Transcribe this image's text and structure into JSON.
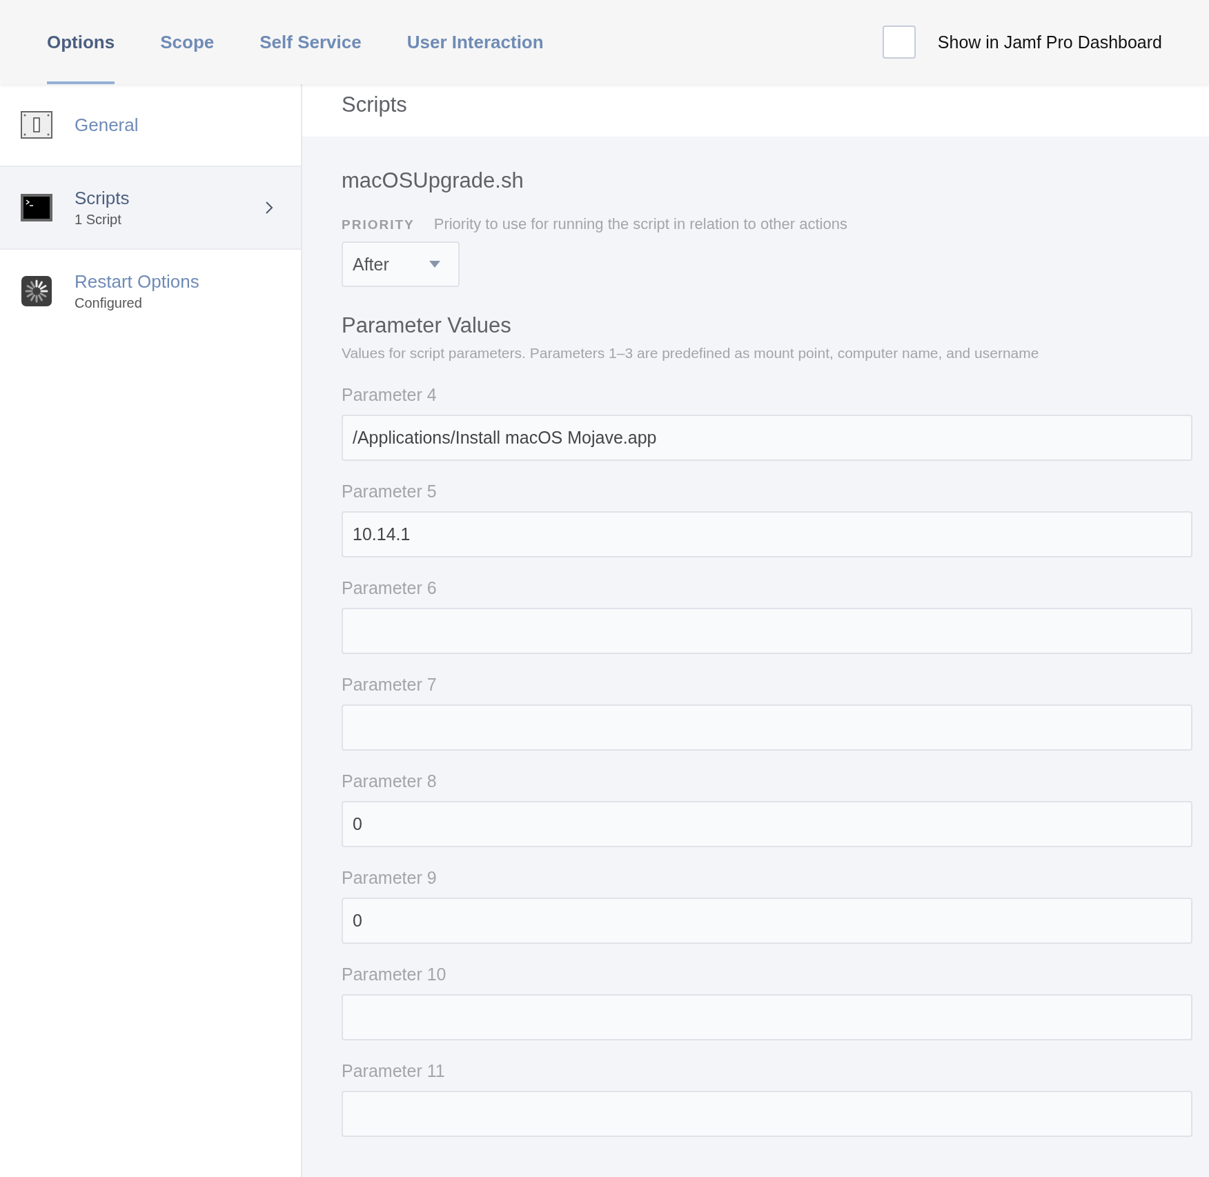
{
  "tabs": [
    {
      "label": "Options",
      "selected": true
    },
    {
      "label": "Scope",
      "selected": false
    },
    {
      "label": "Self Service",
      "selected": false
    },
    {
      "label": "User Interaction",
      "selected": false
    }
  ],
  "dashboard_option": {
    "label": "Show in Jamf Pro Dashboard",
    "checked": false
  },
  "sidebar": {
    "items": [
      {
        "kind": "switch",
        "title": "General",
        "selected": false
      },
      {
        "kind": "terminal",
        "title": "Scripts",
        "subtitle": "1 Script",
        "selected": true
      },
      {
        "kind": "spinner",
        "title": "Restart Options",
        "subtitle": "Configured",
        "selected": false
      }
    ]
  },
  "section_title": "Scripts",
  "script": {
    "name": "macOSUpgrade.sh",
    "priority": {
      "label": "PRIORITY",
      "description": "Priority to use for running the script in relation to other actions",
      "value": "After"
    },
    "parameters_heading": "Parameter Values",
    "parameters_description": "Values for script parameters. Parameters 1–3 are predefined as mount point, computer name, and username",
    "parameters": [
      {
        "label": "Parameter 4",
        "value": "/Applications/Install macOS Mojave.app"
      },
      {
        "label": "Parameter 5",
        "value": "10.14.1"
      },
      {
        "label": "Parameter 6"
      },
      {
        "label": "Parameter 7"
      },
      {
        "label": "Parameter 8",
        "value": "0"
      },
      {
        "label": "Parameter 9",
        "value": "0"
      },
      {
        "label": "Parameter 10"
      },
      {
        "label": "Parameter 11"
      }
    ]
  }
}
